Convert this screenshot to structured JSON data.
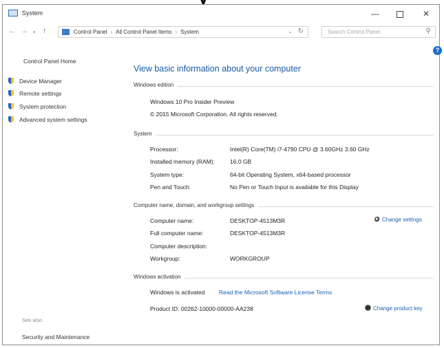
{
  "window": {
    "title": "System",
    "min_label": "—",
    "close_label": "✕"
  },
  "nav": {
    "back": "←",
    "forward": "→",
    "recent": "▾",
    "up": "↑",
    "breadcrumbs": [
      "Control Panel",
      "All Control Panel Items",
      "System"
    ],
    "breadcrumb_sep": "›",
    "dropdown": "⌄",
    "refresh": "↻",
    "search_placeholder": "Search Control Panel",
    "search_icon": "⚲"
  },
  "help_icon_glyph": "?",
  "sidebar": {
    "home": "Control Panel Home",
    "items": [
      {
        "label": "Device Manager",
        "icon": "shield-icon"
      },
      {
        "label": "Remote settings",
        "icon": "shield-icon"
      },
      {
        "label": "System protection",
        "icon": "shield-icon"
      },
      {
        "label": "Advanced system settings",
        "icon": "shield-icon"
      }
    ],
    "see_also": "See also",
    "security_maintenance": "Security and Maintenance"
  },
  "main": {
    "heading": "View basic information about your computer",
    "edition": {
      "title": "Windows edition",
      "name": "Windows 10 Pro Insider Preview",
      "copyright": "© 2015 Microsoft Corporation. All rights reserved."
    },
    "system": {
      "title": "System",
      "rows": [
        {
          "key": "Processor:",
          "value": "Intel(R) Core(TM) i7-4790 CPU @ 3.60GHz   3.60 GHz"
        },
        {
          "key": "Installed memory (RAM):",
          "value": "16.0 GB"
        },
        {
          "key": "System type:",
          "value": "64-bit Operating System, x64-based processor"
        },
        {
          "key": "Pen and Touch:",
          "value": "No Pen or Touch Input is available for this Display"
        }
      ]
    },
    "computer_name": {
      "title": "Computer name, domain, and workgroup settings",
      "change_settings": "Change settings",
      "rows": [
        {
          "key": "Computer name:",
          "value": "DESKTOP-4513M3R"
        },
        {
          "key": "Full computer name:",
          "value": "DESKTOP-4513M3R"
        },
        {
          "key": "Computer description:",
          "value": ""
        },
        {
          "key": "Workgroup:",
          "value": "WORKGROUP"
        }
      ]
    },
    "activation": {
      "title": "Windows activation",
      "status": "Windows is activated",
      "license_link": "Read the Microsoft Software License Terms",
      "product_id": "Product ID: 00262-10000-00000-AA238",
      "change_key": "Change product key"
    }
  }
}
